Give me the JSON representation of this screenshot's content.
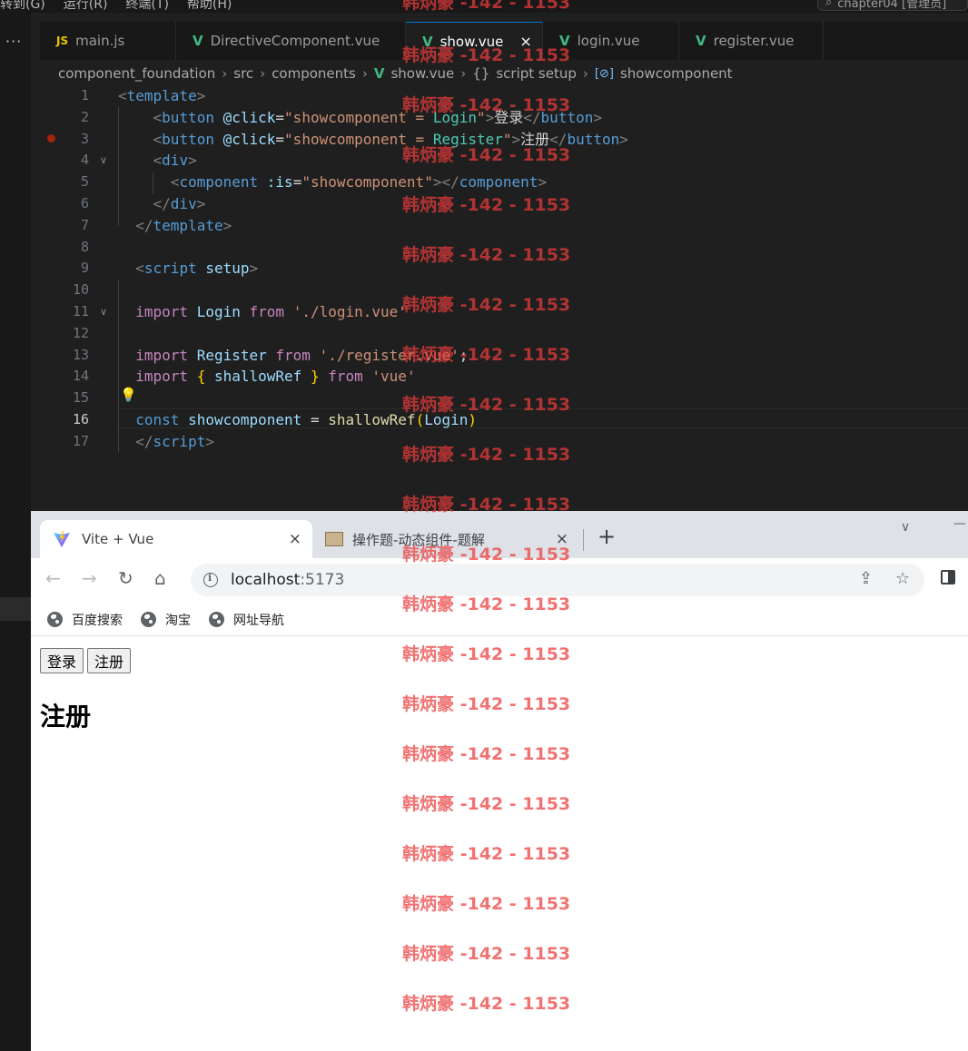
{
  "menubar": {
    "items": [
      "转到(G)",
      "运行(R)",
      "终端(T)",
      "帮助(H)"
    ],
    "command_center": "chapter04 [管理员]"
  },
  "editor": {
    "tabs": [
      {
        "label": "main.js",
        "icon": "js-icon",
        "icon_text": "JS"
      },
      {
        "label": "DirectiveComponent.vue",
        "icon": "vue-icon",
        "icon_text": "V"
      },
      {
        "label": "show.vue",
        "icon": "vue-icon",
        "icon_text": "V",
        "active": true,
        "close": "×"
      },
      {
        "label": "login.vue",
        "icon": "vue-icon",
        "icon_text": "V"
      },
      {
        "label": "register.vue",
        "icon": "vue-icon",
        "icon_text": "V"
      }
    ],
    "breadcrumb": [
      "component_foundation",
      "src",
      "components",
      "show.vue",
      "script setup",
      "showcomponent"
    ],
    "breadcrumb_icons": {
      "vue": "V",
      "braces": "{}",
      "symbol": "[⊘]"
    },
    "current_line": 16,
    "lines": [
      {
        "n": "1",
        "t": [
          [
            "<",
            "t-br"
          ],
          [
            "template",
            "t-tag"
          ],
          [
            ">",
            "t-br"
          ]
        ]
      },
      {
        "n": "2",
        "t": [
          [
            "    ",
            ""
          ],
          [
            "<",
            "t-br"
          ],
          [
            "button",
            "t-tag"
          ],
          [
            " ",
            ""
          ],
          [
            "@click",
            "t-attr"
          ],
          [
            "=",
            "t-white"
          ],
          [
            "\"showcomponent = ",
            "t-str"
          ],
          [
            "Login",
            "t-cls"
          ],
          [
            "\"",
            "t-str"
          ],
          [
            ">",
            "t-br"
          ],
          [
            "登录",
            "t-white"
          ],
          [
            "</",
            "t-br"
          ],
          [
            "button",
            "t-tag"
          ],
          [
            ">",
            "t-br"
          ]
        ]
      },
      {
        "n": "3",
        "t": [
          [
            "    ",
            ""
          ],
          [
            "<",
            "t-br"
          ],
          [
            "button",
            "t-tag"
          ],
          [
            " ",
            ""
          ],
          [
            "@click",
            "t-attr"
          ],
          [
            "=",
            "t-white"
          ],
          [
            "\"showcomponent = ",
            "t-str"
          ],
          [
            "Register",
            "t-cls"
          ],
          [
            "\"",
            "t-str"
          ],
          [
            ">",
            "t-br"
          ],
          [
            "注册",
            "t-white"
          ],
          [
            "</",
            "t-br"
          ],
          [
            "button",
            "t-tag"
          ],
          [
            ">",
            "t-br"
          ]
        ]
      },
      {
        "n": "4",
        "t": [
          [
            "    ",
            ""
          ],
          [
            "<",
            "t-br"
          ],
          [
            "div",
            "t-tag"
          ],
          [
            ">",
            "t-br"
          ]
        ]
      },
      {
        "n": "5",
        "t": [
          [
            "      ",
            ""
          ],
          [
            "<",
            "t-br"
          ],
          [
            "component",
            "t-tag"
          ],
          [
            " ",
            ""
          ],
          [
            ":is",
            "t-attr"
          ],
          [
            "=",
            "t-white"
          ],
          [
            "\"showcomponent\"",
            "t-str"
          ],
          [
            ">",
            "t-br"
          ],
          [
            "</",
            "t-br"
          ],
          [
            "component",
            "t-tag"
          ],
          [
            ">",
            "t-br"
          ]
        ]
      },
      {
        "n": "6",
        "t": [
          [
            "    ",
            ""
          ],
          [
            "</",
            "t-br"
          ],
          [
            "div",
            "t-tag"
          ],
          [
            ">",
            "t-br"
          ]
        ]
      },
      {
        "n": "7",
        "t": [
          [
            "  ",
            ""
          ],
          [
            "</",
            "t-br"
          ],
          [
            "template",
            "t-tag"
          ],
          [
            ">",
            "t-br"
          ]
        ]
      },
      {
        "n": "8",
        "t": []
      },
      {
        "n": "9",
        "t": [
          [
            "  ",
            ""
          ],
          [
            "<",
            "t-br"
          ],
          [
            "script",
            "t-tag"
          ],
          [
            " ",
            ""
          ],
          [
            "setup",
            "t-attr"
          ],
          [
            ">",
            "t-br"
          ]
        ]
      },
      {
        "n": "10",
        "t": []
      },
      {
        "n": "11",
        "t": [
          [
            "  ",
            ""
          ],
          [
            "import",
            "t-kw"
          ],
          [
            " ",
            ""
          ],
          [
            "Login",
            "t-var"
          ],
          [
            " ",
            ""
          ],
          [
            "from",
            "t-kw"
          ],
          [
            " ",
            ""
          ],
          [
            "'./login.vue'",
            "t-str"
          ]
        ]
      },
      {
        "n": "12",
        "t": []
      },
      {
        "n": "13",
        "t": [
          [
            "  ",
            ""
          ],
          [
            "import",
            "t-kw"
          ],
          [
            " ",
            ""
          ],
          [
            "Register",
            "t-var"
          ],
          [
            " ",
            ""
          ],
          [
            "from",
            "t-kw"
          ],
          [
            " ",
            ""
          ],
          [
            "'./register.vue'",
            "t-str"
          ],
          [
            ";",
            "t-white"
          ]
        ]
      },
      {
        "n": "14",
        "t": [
          [
            "  ",
            ""
          ],
          [
            "import",
            "t-kw"
          ],
          [
            " ",
            ""
          ],
          [
            "{",
            "t-brace"
          ],
          [
            " ",
            ""
          ],
          [
            "shallowRef",
            "t-var"
          ],
          [
            " ",
            ""
          ],
          [
            "}",
            "t-brace"
          ],
          [
            " ",
            ""
          ],
          [
            "from",
            "t-kw"
          ],
          [
            " ",
            ""
          ],
          [
            "'vue'",
            "t-str"
          ]
        ]
      },
      {
        "n": "15",
        "t": []
      },
      {
        "n": "16",
        "t": [
          [
            "  ",
            ""
          ],
          [
            "const",
            "t-const"
          ],
          [
            " ",
            ""
          ],
          [
            "showcomponent",
            "t-var"
          ],
          [
            " ",
            ""
          ],
          [
            "=",
            "t-white"
          ],
          [
            " ",
            ""
          ],
          [
            "shallowRef",
            "t-fn"
          ],
          [
            "(",
            "t-brace"
          ],
          [
            "Login",
            "t-var"
          ],
          [
            ")",
            "t-brace"
          ]
        ]
      },
      {
        "n": "17",
        "t": [
          [
            "  ",
            ""
          ],
          [
            "</",
            "t-br"
          ],
          [
            "script",
            "t-tag"
          ],
          [
            ">",
            "t-br"
          ]
        ]
      }
    ]
  },
  "browser": {
    "tabs": [
      {
        "title": "Vite + Vue",
        "active": true,
        "close": "×"
      },
      {
        "title": "操作题-动态组件-题解",
        "active": false,
        "close": "×"
      }
    ],
    "new_tab": "+",
    "url_host": "localhost",
    "url_port": ":5173",
    "bookmarks": [
      "百度搜索",
      "淘宝",
      "网址导航"
    ],
    "page": {
      "buttons": [
        "登录",
        "注册"
      ],
      "heading": "注册"
    }
  },
  "watermark": {
    "text": "韩炳豪 -142 - 1153"
  },
  "colors": {
    "vscode_bg": "#1f1f1f",
    "vue_green": "#41b883",
    "accent_blue": "#0078d4",
    "watermark_red": "#eb3c3c"
  }
}
